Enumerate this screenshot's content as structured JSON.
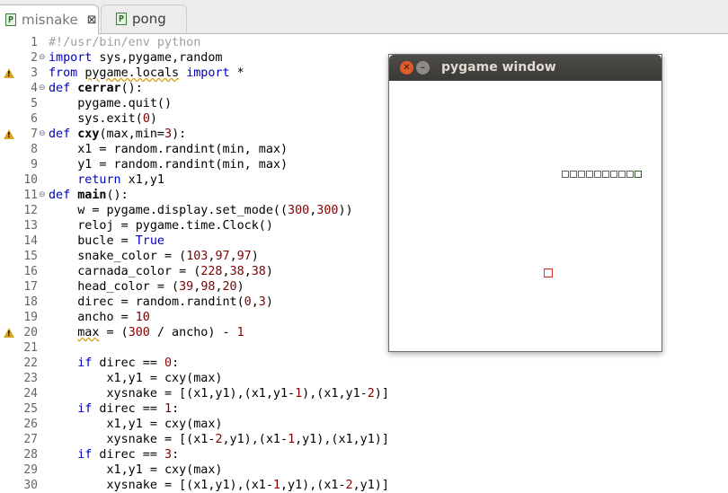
{
  "tabs": [
    {
      "label": "misnake",
      "icon": "python-file-icon",
      "close": "⊠",
      "active": true
    },
    {
      "label": "pong",
      "icon": "python-file-icon",
      "active": false
    }
  ],
  "line_numbers": [
    "1",
    "2",
    "3",
    "4",
    "5",
    "6",
    "7",
    "8",
    "9",
    "10",
    "11",
    "12",
    "13",
    "14",
    "15",
    "16",
    "17",
    "18",
    "19",
    "20",
    "21",
    "22",
    "23",
    "24",
    "25",
    "26",
    "27",
    "28",
    "29",
    "30"
  ],
  "code": {
    "l1": "#!/usr/bin/env python",
    "l2": "import sys,pygame,random",
    "l3": "from pygame.locals import *",
    "l4": "def cerrar():",
    "l5": "    pygame.quit()",
    "l6": "    sys.exit(0)",
    "l7": "def cxy(max,min=3):",
    "l8": "    x1 = random.randint(min, max)",
    "l9": "    y1 = random.randint(min, max)",
    "l10": "    return x1,y1",
    "l11": "def main():",
    "l12": "    w = pygame.display.set_mode((300,300))",
    "l13": "    reloj = pygame.time.Clock()",
    "l14": "    bucle = True",
    "l15": "    snake_color = (103,97,97)",
    "l16": "    carnada_color = (228,38,38)",
    "l17": "    head_color = (39,98,20)",
    "l18": "    direc = random.randint(0,3)",
    "l19": "    ancho = 10",
    "l20": "    max = (300 / ancho) - 1",
    "l21": "",
    "l22": "    if direc == 0:",
    "l23": "        x1,y1 = cxy(max)",
    "l24": "        xysnake = [(x1,y1),(x1,y1-1),(x1,y1-2)]",
    "l25": "    if direc == 1:",
    "l26": "        x1,y1 = cxy(max)",
    "l27": "        xysnake = [(x1-2,y1),(x1-1,y1),(x1,y1)]",
    "l28": "    if direc == 3:",
    "l29": "        x1,y1 = cxy(max)",
    "l30": "        xysnake = [(x1,y1),(x1-1,y1),(x1-2,y1)]"
  },
  "warnings_on_lines": [
    3,
    7,
    20
  ],
  "pygame_window": {
    "title": "pygame window",
    "snake_segments": 10,
    "snake_color": "#676161",
    "head_color": "#27621c",
    "bait_color": "#e42626"
  }
}
